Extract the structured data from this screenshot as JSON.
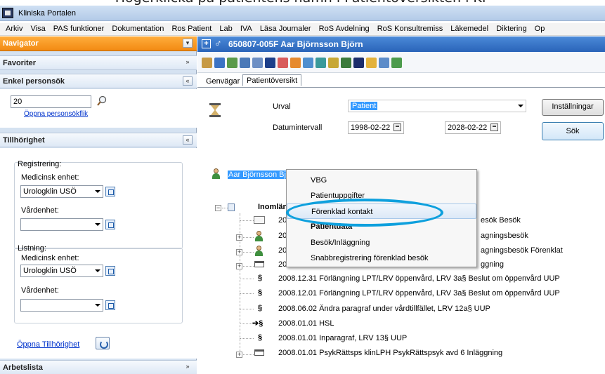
{
  "caption": "Högerklicka på patientens namn i Patientöversikten i KP",
  "window": {
    "title": "Kliniska Portalen"
  },
  "menu": [
    "Arkiv",
    "Visa",
    "PAS funktioner",
    "Dokumentation",
    "Ros Patient",
    "Lab",
    "IVA",
    "Läsa Journaler",
    "RoS Avdelning",
    "RoS Konsultremiss",
    "Läkemedel",
    "Diktering",
    "Op"
  ],
  "navigator": {
    "title": "Navigator",
    "favoriter": "Favoriter",
    "enkel": {
      "title": "Enkel personsök",
      "value": "20",
      "link": "Öppna personsökflik"
    },
    "tillhorighet": {
      "title": "Tillhörighet",
      "registrering": "Registrering:",
      "med_enhet_label": "Medicinsk enhet:",
      "med_enhet_value": "Urologklin USÖ",
      "vardenhet_label": "Vårdenhet:",
      "vardenhet_value": "",
      "listning": "Listning:",
      "list_med_enhet_label": "Medicinsk enhet:",
      "list_med_enhet_value": "Urologklin USÖ",
      "list_vardenhet_label": "Vårdenhet:",
      "list_vardenhet_value": "",
      "open_link": "Öppna Tillhörighet"
    },
    "arbetslista": "Arbetslista"
  },
  "patient": {
    "header": "650807-005F  Aar Björnsson Björn",
    "name": "Aar Björnsson Björn"
  },
  "tabs": [
    "Genvägar",
    "Patientöversikt"
  ],
  "filter": {
    "urval_label": "Urval",
    "urval_value": "Patient",
    "datum_label": "Datumintervall",
    "from": "1998-02-22",
    "to": "2028-02-22",
    "settings_button": "Inställningar",
    "search_button": "Sök"
  },
  "tree": {
    "root": "Inomlänsv",
    "rows": [
      {
        "date": "20",
        "tail": "esök Besök"
      },
      {
        "date": "20",
        "tail": "agningsbesök"
      },
      {
        "date": "20",
        "tail": "agningsbesök Förenklat"
      },
      {
        "date": "200",
        "tail": "ggning"
      },
      {
        "text": "2008.12.31 Förlängning LPT/LRV öppenvård,  LRV 3a§ Beslut om öppenvård UUP"
      },
      {
        "text": "2008.12.01 Förlängning LPT/LRV öppenvård,  LRV 3a§ Beslut om öppenvård UUP"
      },
      {
        "text": "2008.06.02 Ändra paragraf under vårdtillfället,  LRV 12a§ UUP"
      },
      {
        "text": "2008.01.01 HSL"
      },
      {
        "text": "2008.01.01 Inparagraf,  LRV 13§ UUP"
      },
      {
        "text": "2008.01.01 PsykRättsps klinLPH PsykRättspsyk avd 6 Inläggning"
      }
    ]
  },
  "context_menu": {
    "items": [
      "VBG",
      "Patientuppgifter",
      "Förenklad kontakt",
      "Patientdata",
      "Besök/Inläggning",
      "Snabbregistrering förenklad besök"
    ],
    "highlighted": "Förenklad kontakt"
  },
  "colors": {
    "nav_header": "#f28a13",
    "patient_header": "#2a64b9",
    "highlight_circle": "#0ea0dd"
  }
}
